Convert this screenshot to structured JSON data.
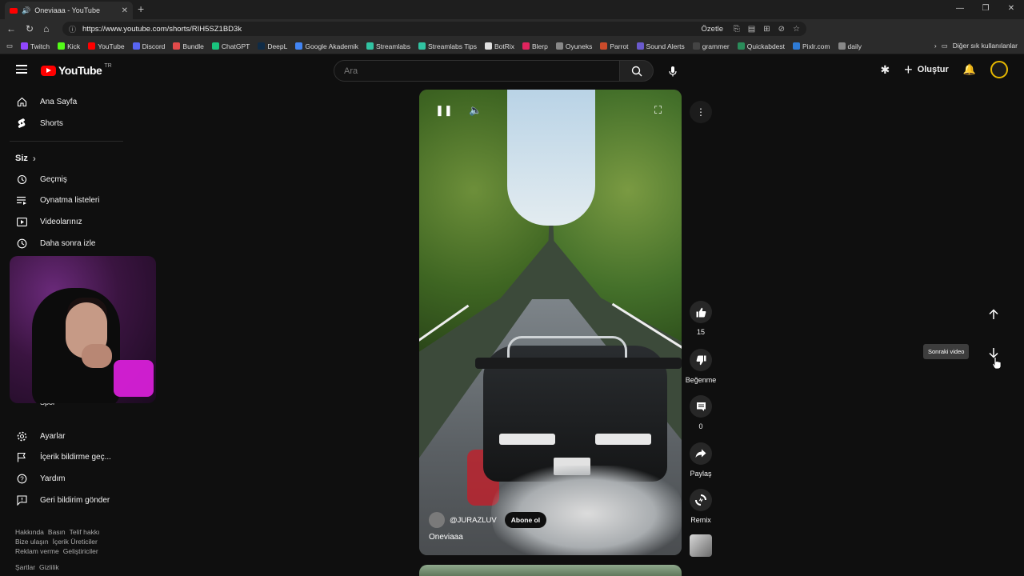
{
  "browser": {
    "tab_title": "Oneviaaa - YouTube",
    "url": "https://www.youtube.com/shorts/RIH5SZ1BD3k",
    "summary_label": "Özetle",
    "bookmarks": [
      "Twitch",
      "Kick",
      "YouTube",
      "Discord",
      "Bundle",
      "ChatGPT",
      "DeepL",
      "Google Akademik",
      "Streamlabs",
      "Streamlabs Tips",
      "BotRix",
      "Blerp",
      "Oyuneks",
      "Parrot",
      "Sound Alerts",
      "grammer",
      "Quickabdest",
      "Pixlr.com",
      "daily"
    ],
    "bookmark_colors": [
      "#9146ff",
      "#53fc18",
      "#ff0000",
      "#5865f2",
      "#e24a4a",
      "#19c37d",
      "#0f2b46",
      "#4285f4",
      "#31c3a2",
      "#31c3a2",
      "#e0e0e0",
      "#e0245e",
      "#888888",
      "#cc4b2b",
      "#6a5acd",
      "#444444",
      "#2a8c5a",
      "#2e7bd6",
      "#888888"
    ],
    "other_bookmarks": "Diğer sık kullanılanlar"
  },
  "masthead": {
    "logo": "YouTube",
    "country": "TR",
    "search_placeholder": "Ara",
    "create_label": "Oluştur"
  },
  "sidebar": {
    "home": "Ana Sayfa",
    "shorts": "Shorts",
    "you_header": "Siz",
    "history": "Geçmiş",
    "playlists": "Oynatma listeleri",
    "your_videos": "Videolarınız",
    "watch_later": "Daha sonra izle",
    "sports": "Spor",
    "settings": "Ayarlar",
    "report": "İçerik bildirme geç...",
    "help": "Yardım",
    "feedback": "Geri bildirim gönder",
    "footer1": [
      "Hakkında",
      "Basın",
      "Telif hakkı"
    ],
    "footer2": [
      "Bize ulaşın",
      "İçerik Üreticiler"
    ],
    "footer3": [
      "Reklam verme",
      "Geliştiriciler"
    ],
    "footer4": [
      "Şartlar",
      "Gizlilik"
    ]
  },
  "short": {
    "channel": "@JURAZLUV",
    "subscribe": "Abone ol",
    "title": "Oneviaaa"
  },
  "actions": {
    "like_count": "15",
    "dislike_label": "Beğenme",
    "comment_count": "0",
    "share_label": "Paylaş",
    "remix_label": "Remix"
  },
  "navigation": {
    "next_tooltip": "Sonraki video"
  },
  "colors": {
    "background": "#0f0f0f",
    "brand_red": "#ff0000",
    "avatar_ring": "#e6b800"
  }
}
